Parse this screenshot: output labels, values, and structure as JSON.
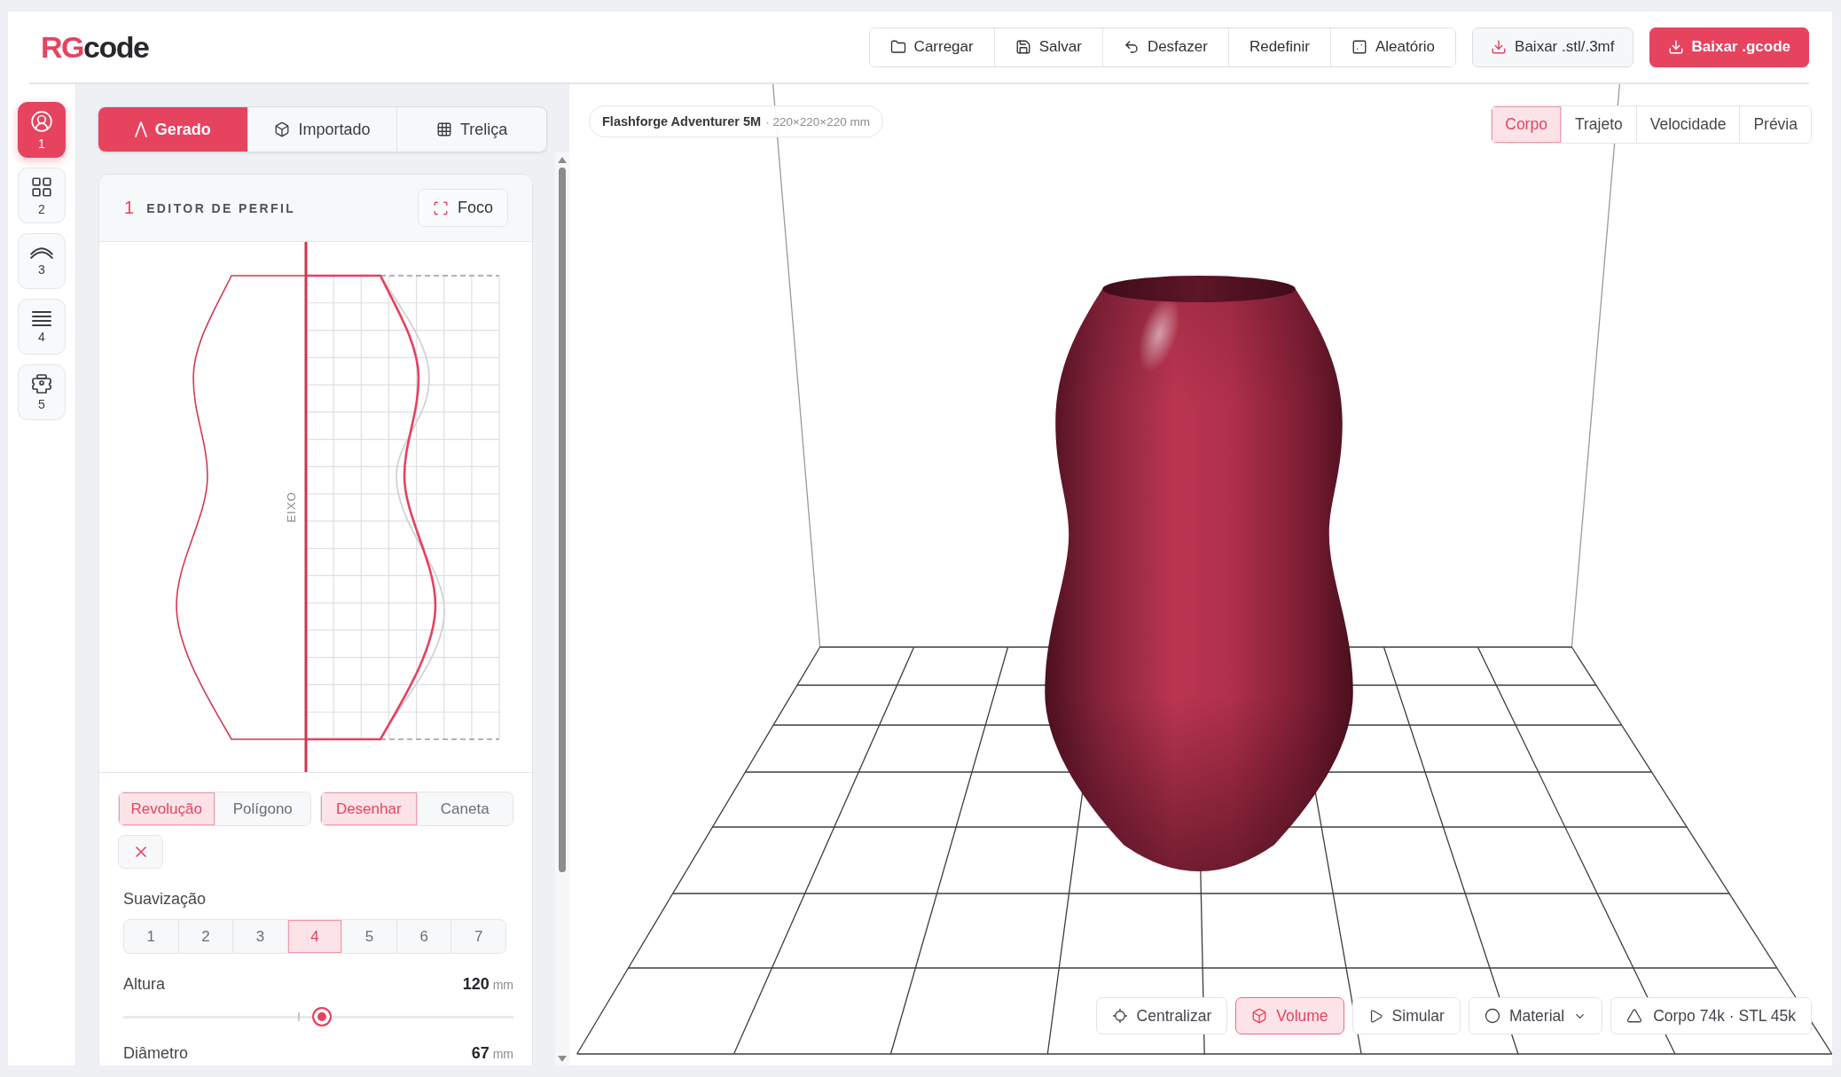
{
  "header": {
    "logo": {
      "accent": "RG",
      "text": "code"
    },
    "actions": [
      "Carregar",
      "Salvar",
      "Desfazer",
      "Redefinir",
      "Aleatório"
    ],
    "downloads": [
      {
        "label": "Baixar .stl/.3mf",
        "kind": "secondary"
      },
      {
        "label": "Baixar .gcode",
        "kind": "primary"
      }
    ]
  },
  "steps": [
    {
      "number": "1",
      "selected": true
    },
    {
      "number": "2",
      "selected": false
    },
    {
      "number": "3",
      "selected": false
    },
    {
      "number": "4",
      "selected": false
    },
    {
      "number": "5",
      "selected": false
    }
  ],
  "source_tabs": [
    {
      "label": "Gerado",
      "selected": true
    },
    {
      "label": "Importado",
      "selected": false
    },
    {
      "label": "Treliça",
      "selected": false
    }
  ],
  "profile_editor": {
    "step": "1",
    "title": "EDITOR DE PERFIL",
    "focus_button": "Foco",
    "axis_label": "EIXO",
    "shape_modes": [
      {
        "label": "Revolução",
        "selected": true
      },
      {
        "label": "Polígono",
        "selected": false
      }
    ],
    "draw_modes": [
      {
        "label": "Desenhar",
        "selected": true
      },
      {
        "label": "Caneta",
        "selected": false
      }
    ],
    "smoothing": {
      "label": "Suavização",
      "options": [
        {
          "label": "1",
          "selected": false
        },
        {
          "label": "2",
          "selected": false
        },
        {
          "label": "3",
          "selected": false
        },
        {
          "label": "4",
          "selected": true
        },
        {
          "label": "5",
          "selected": false
        },
        {
          "label": "6",
          "selected": false
        },
        {
          "label": "7",
          "selected": false
        }
      ]
    },
    "sliders": [
      {
        "label": "Altura",
        "value": "120",
        "unit": "mm",
        "level": 0.51
      },
      {
        "label": "Diâmetro",
        "value": "67",
        "unit": "mm"
      }
    ]
  },
  "viewport": {
    "printer": {
      "name": "Flashforge Adventurer 5M",
      "spec": "· 220×220×220 mm"
    },
    "view_tabs": [
      {
        "label": "Corpo",
        "selected": true
      },
      {
        "label": "Trajeto",
        "selected": false
      },
      {
        "label": "Velocidade",
        "selected": false
      },
      {
        "label": "Prévia",
        "selected": false
      }
    ],
    "toolbar": [
      {
        "label": "Centralizar",
        "kind": "button"
      },
      {
        "label": "Volume",
        "kind": "toggle",
        "on": true
      },
      {
        "label": "Simular",
        "kind": "button"
      },
      {
        "label": "Material",
        "kind": "dropdown"
      },
      {
        "label": "Corpo 74k · STL 45k",
        "kind": "info"
      }
    ]
  }
}
